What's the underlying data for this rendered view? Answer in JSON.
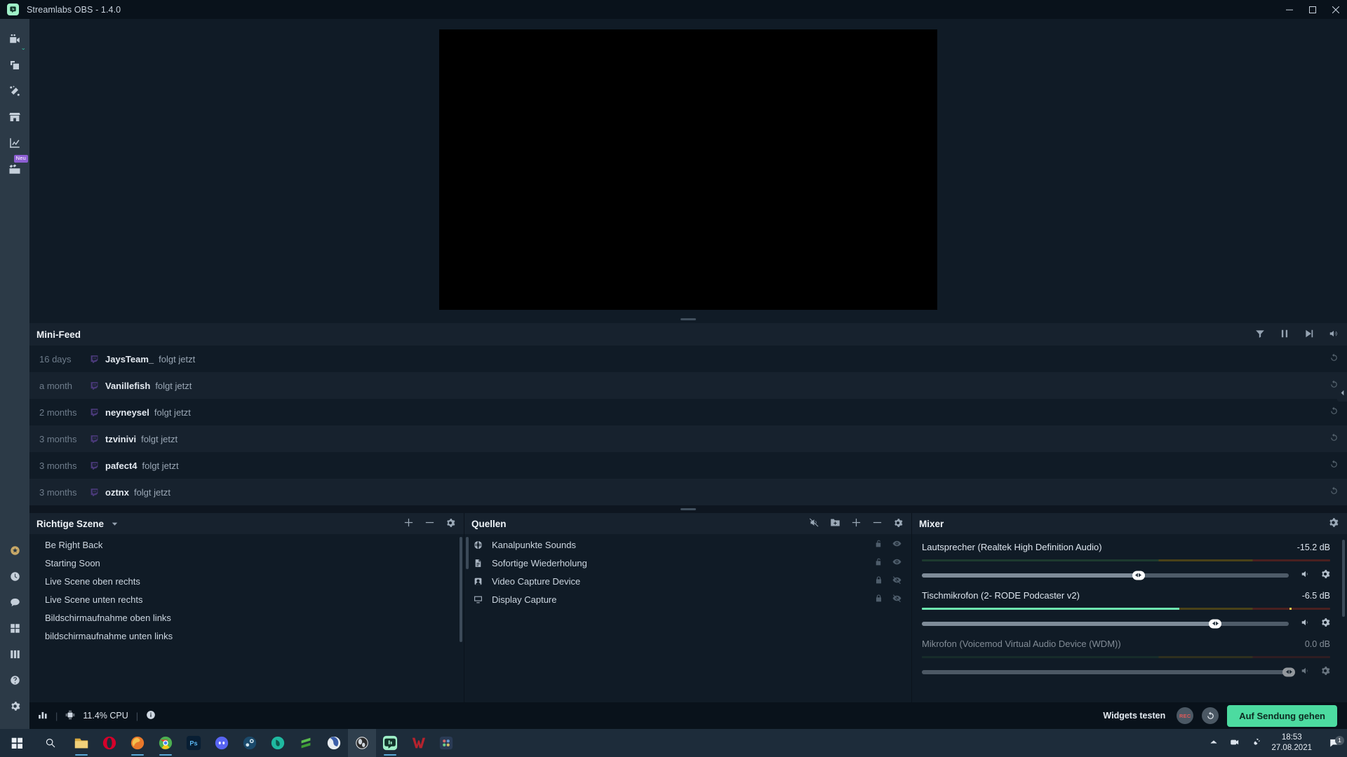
{
  "window": {
    "title": "Streamlabs OBS - 1.4.0",
    "logo_icon": "streamlabs-logo",
    "minimize_icon": "minimize-icon",
    "maximize_icon": "maximize-icon",
    "close_icon": "close-icon"
  },
  "nav_rail": {
    "top_items": [
      {
        "icon": "video-camera-icon",
        "name": "editor",
        "has_caret": true,
        "badge": null
      },
      {
        "icon": "layers-icon",
        "name": "themes",
        "has_caret": false,
        "badge": null
      },
      {
        "icon": "magic-wand-icon",
        "name": "alert-box",
        "has_caret": false,
        "badge": null
      },
      {
        "icon": "store-icon",
        "name": "store",
        "has_caret": false,
        "badge": null
      },
      {
        "icon": "chart-line-icon",
        "name": "dashboard",
        "has_caret": false,
        "badge": null
      },
      {
        "icon": "clapperboard-icon",
        "name": "highlighter",
        "has_caret": false,
        "badge": "Neu"
      }
    ],
    "bottom_items": [
      {
        "icon": "star-prime-icon",
        "name": "prime"
      },
      {
        "icon": "clock-icon",
        "name": "recent-events"
      },
      {
        "icon": "chat-bubble-icon",
        "name": "chat"
      },
      {
        "icon": "grid-icon",
        "name": "layout-editor"
      },
      {
        "icon": "columns-icon",
        "name": "studio-mode"
      },
      {
        "icon": "question-icon",
        "name": "help"
      },
      {
        "icon": "gear-icon",
        "name": "settings"
      }
    ],
    "badge_new": "Neu"
  },
  "minifeed": {
    "title": "Mini-Feed",
    "tools": [
      {
        "icon": "filter-icon",
        "name": "filter"
      },
      {
        "icon": "pause-icon",
        "name": "pause-feed"
      },
      {
        "icon": "skip-icon",
        "name": "skip-alert"
      },
      {
        "icon": "volume-icon",
        "name": "mute-alerts"
      }
    ],
    "events": [
      {
        "time": "16 days",
        "platform_icon": "twitch-icon",
        "user": "JaysTeam_",
        "action": "folgt jetzt",
        "replay_icon": "replay-icon"
      },
      {
        "time": "a month",
        "platform_icon": "twitch-icon",
        "user": "Vanillefish",
        "action": "folgt jetzt",
        "replay_icon": "replay-icon"
      },
      {
        "time": "2 months",
        "platform_icon": "twitch-icon",
        "user": "neyneysel",
        "action": "folgt jetzt",
        "replay_icon": "replay-icon"
      },
      {
        "time": "3 months",
        "platform_icon": "twitch-icon",
        "user": "tzvinivi",
        "action": "folgt jetzt",
        "replay_icon": "replay-icon"
      },
      {
        "time": "3 months",
        "platform_icon": "twitch-icon",
        "user": "pafect4",
        "action": "folgt jetzt",
        "replay_icon": "replay-icon"
      },
      {
        "time": "3 months",
        "platform_icon": "twitch-icon",
        "user": "oztnx",
        "action": "folgt jetzt",
        "replay_icon": "replay-icon"
      }
    ]
  },
  "scenes": {
    "title": "Richtige Szene",
    "caret_icon": "chevron-down-icon",
    "actions": [
      {
        "icon": "plus-icon",
        "name": "add-scene"
      },
      {
        "icon": "minus-icon",
        "name": "remove-scene"
      },
      {
        "icon": "gear-icon",
        "name": "scene-settings"
      }
    ],
    "items": [
      "Be Right Back",
      "Starting Soon",
      "Live Scene oben rechts",
      "Live Scene unten rechts",
      "Bildschirmaufnahme oben links",
      "bildschirmaufnahme unten links"
    ]
  },
  "sources": {
    "title": "Quellen",
    "actions": [
      {
        "icon": "audio-mixer-icon",
        "name": "open-mixer"
      },
      {
        "icon": "folder-plus-icon",
        "name": "add-group"
      },
      {
        "icon": "plus-icon",
        "name": "add-source"
      },
      {
        "icon": "minus-icon",
        "name": "remove-source"
      },
      {
        "icon": "gear-icon",
        "name": "source-settings"
      }
    ],
    "items": [
      {
        "icon": "globe-icon",
        "name": "Kanalpunkte Sounds",
        "locked": false,
        "visible": true
      },
      {
        "icon": "file-icon",
        "name": "Sofortige Wiederholung",
        "locked": false,
        "visible": true
      },
      {
        "icon": "webcam-icon",
        "name": "Video Capture Device",
        "locked": true,
        "visible": false
      },
      {
        "icon": "monitor-icon",
        "name": "Display Capture",
        "locked": true,
        "visible": false
      }
    ]
  },
  "mixer": {
    "title": "Mixer",
    "settings_icon": "gear-icon",
    "channels": [
      {
        "name": "Lautsprecher (Realtek High Definition Audio)",
        "db": "-15.2 dB",
        "meter_level_pct": 0,
        "peak_pct": null,
        "volume_pct": 59,
        "mute_icon": "volume-icon",
        "settings_icon": "gear-icon"
      },
      {
        "name": "Tischmikrofon (2- RODE Podcaster v2)",
        "db": "-6.5 dB",
        "meter_level_pct": 63,
        "peak_pct": 90,
        "volume_pct": 80,
        "mute_icon": "volume-icon",
        "settings_icon": "gear-icon"
      },
      {
        "name": "Mikrofon (Voicemod Virtual Audio Device (WDM))",
        "db": "0.0 dB",
        "meter_level_pct": 0,
        "peak_pct": null,
        "volume_pct": 100,
        "mute_icon": "volume-icon",
        "settings_icon": "gear-icon"
      }
    ]
  },
  "statusbar": {
    "stats_icon": "bar-stats-icon",
    "cpu_icon": "cpu-icon",
    "cpu": "11.4% CPU",
    "info_icon": "info-icon",
    "separator": "|",
    "widgets_label": "Widgets testen",
    "rec_label": "REC",
    "replay_icon": "replay-buffer-icon",
    "go_live_label": "Auf Sendung gehen"
  },
  "taskbar": {
    "start_icon": "windows-start-icon",
    "search_icon": "search-icon",
    "apps": [
      {
        "name": "file-explorer",
        "glyph": "",
        "color": "#e8bd5a",
        "running": true,
        "active": false
      },
      {
        "name": "opera",
        "glyph": "O",
        "color": "#d6002a",
        "running": false,
        "active": false
      },
      {
        "name": "firefox",
        "glyph": "",
        "color": "#e8782a",
        "running": true,
        "active": false
      },
      {
        "name": "google-chrome",
        "glyph": "",
        "color": "#4a90e2",
        "running": true,
        "active": false
      },
      {
        "name": "photoshop",
        "glyph": "Ps",
        "color": "#081e33",
        "running": false,
        "active": false
      },
      {
        "name": "discord",
        "glyph": "",
        "color": "#5865f2",
        "running": false,
        "active": false
      },
      {
        "name": "steam",
        "glyph": "",
        "color": "#1b2838",
        "running": false,
        "active": false
      },
      {
        "name": "teal-app",
        "glyph": "",
        "color": "#1fb9a0",
        "running": false,
        "active": false
      },
      {
        "name": "sublime-text",
        "glyph": "",
        "color": "#4fae4e",
        "running": false,
        "active": false
      },
      {
        "name": "brave-or-globe",
        "glyph": "",
        "color": "#d9dde2",
        "running": false,
        "active": false
      },
      {
        "name": "obs-studio",
        "glyph": "",
        "color": "#2b2b2b",
        "running": false,
        "active": true
      },
      {
        "name": "streamlabs-obs",
        "glyph": "",
        "color": "#9ff0c8",
        "running": true,
        "active": false
      },
      {
        "name": "wondershare",
        "glyph": "W",
        "color": "#b5232e",
        "running": false,
        "active": false
      },
      {
        "name": "davinci-resolve",
        "glyph": "",
        "color": "#2a3b55",
        "running": false,
        "active": false
      }
    ],
    "tray": [
      {
        "icon": "chevron-up-icon",
        "name": "show-hidden-icons"
      },
      {
        "icon": "camera-icon",
        "name": "capture-tray"
      },
      {
        "icon": "plug-icon",
        "name": "device-tray"
      }
    ],
    "time": "18:53",
    "date": "27.08.2021",
    "notification_icon": "notification-icon",
    "notification_count": "1"
  }
}
